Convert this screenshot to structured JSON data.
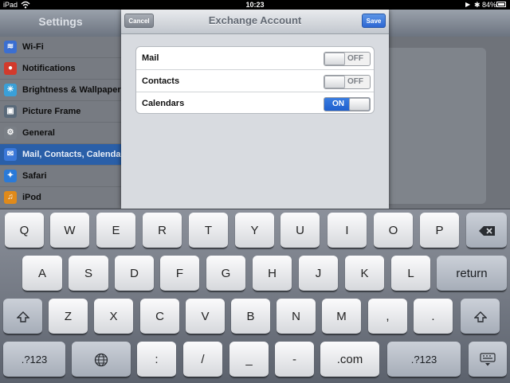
{
  "status_bar": {
    "carrier": "iPad",
    "time": "10:23",
    "battery": "84%",
    "battery_level_pct": 84,
    "icons": [
      "wifi-icon",
      "play-icon",
      "bluetooth-icon",
      "battery-icon"
    ]
  },
  "settings": {
    "title": "Settings",
    "items": [
      {
        "label": "Wi-Fi",
        "icon": "wifi-settings-icon",
        "color": "#3b6fd1"
      },
      {
        "label": "Notifications",
        "icon": "notifications-icon",
        "color": "#d23a2c"
      },
      {
        "label": "Brightness & Wallpaper",
        "icon": "brightness-icon",
        "color": "#3aa0d8"
      },
      {
        "label": "Picture Frame",
        "icon": "picture-frame-icon",
        "color": "#5a6a7a"
      },
      {
        "label": "General",
        "icon": "gear-icon",
        "color": "#7a7f86"
      },
      {
        "label": "Mail, Contacts, Calendars",
        "icon": "mail-icon",
        "color": "#3b78d8",
        "selected": true
      },
      {
        "label": "Safari",
        "icon": "safari-icon",
        "color": "#2a7ad8"
      },
      {
        "label": "iPod",
        "icon": "ipod-icon",
        "color": "#e08a1a"
      }
    ]
  },
  "modal": {
    "title": "Exchange Account",
    "cancel_label": "Cancel",
    "save_label": "Save",
    "toggles": [
      {
        "label": "Mail",
        "state": "OFF",
        "on": false
      },
      {
        "label": "Contacts",
        "state": "OFF",
        "on": false
      },
      {
        "label": "Calendars",
        "state": "ON",
        "on": true
      }
    ]
  },
  "keyboard": {
    "row1": [
      "Q",
      "W",
      "E",
      "R",
      "T",
      "Y",
      "U",
      "I",
      "O",
      "P"
    ],
    "row2": [
      "A",
      "S",
      "D",
      "F",
      "G",
      "H",
      "J",
      "K",
      "L"
    ],
    "row3": [
      "Z",
      "X",
      "C",
      "V",
      "B",
      "N",
      "M",
      ",",
      "."
    ],
    "row4": [
      ".?123",
      ":",
      "/",
      "_",
      "-",
      ".com",
      ".?123"
    ],
    "return_label": "return",
    "icons": [
      "backspace-icon",
      "shift-icon",
      "globe-icon",
      "keyboard-dismiss-icon"
    ],
    "accent": "#2d67d3"
  }
}
